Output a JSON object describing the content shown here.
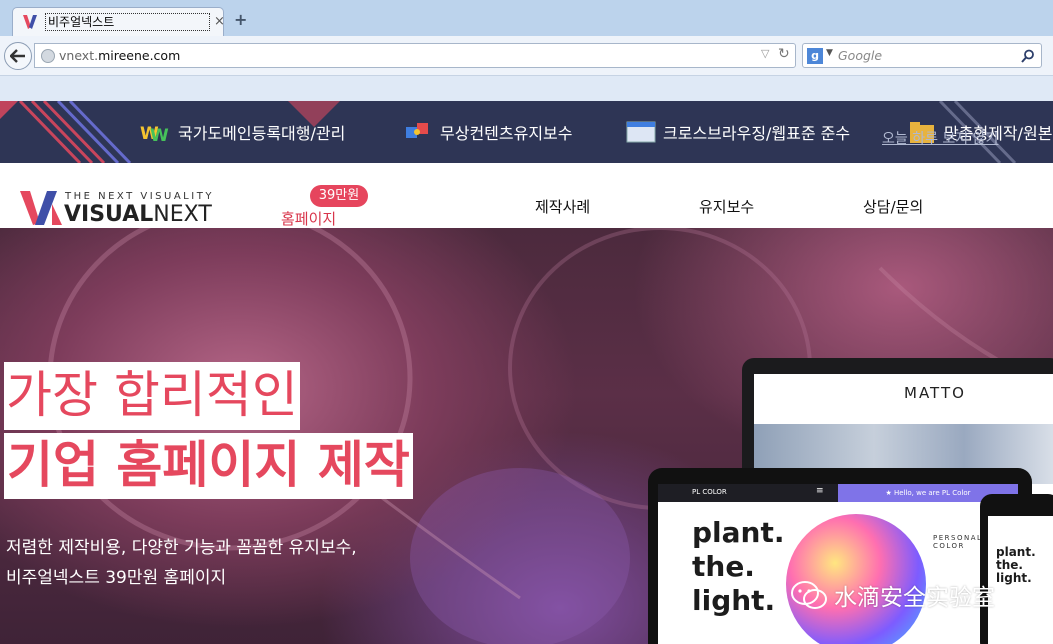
{
  "browser": {
    "tab_title": "비주얼넥스트",
    "tab_close": "×",
    "new_tab": "+",
    "url_domain_prefix": "vnext.",
    "url_domain": "mireene",
    "url_suffix": ".com",
    "search_placeholder": "Google",
    "search_engine_letter": "g"
  },
  "banner": {
    "items": [
      {
        "label": "국가도메인등록대행/관리",
        "icon": "www-icon"
      },
      {
        "label": "무상컨텐츠유지보수",
        "icon": "puzzle-icon"
      },
      {
        "label": "크로스브라우징/웹표준 준수",
        "icon": "browser-window-icon"
      },
      {
        "label": "맞춤형제작/원본",
        "icon": "folder-icon"
      }
    ],
    "dismiss_link": "오늘 하루 보지 않기"
  },
  "header": {
    "logo_tagline": "THE NEXT VISUALITY",
    "logo_bold": "VISUAL",
    "logo_light": "NEXT",
    "promo_badge": "39만원",
    "promo_label": "홈페이지",
    "nav": [
      "제작사례",
      "유지보수",
      "상담/문의"
    ]
  },
  "hero": {
    "headline_1": "가장 합리적인",
    "headline_2": "기업 홈페이지 제작",
    "sub_1": "저렴한 제작비용, 다양한 기능과 꼼꼼한 유지보수,",
    "sub_2": "비주얼넥스트 39만원 홈페이지",
    "laptop_brand": "MATTO",
    "tablet_brand": "PL COLOR",
    "tablet_hello": "★ Hello, we are PL Color",
    "tablet_big_1": "plant.",
    "tablet_big_2": "the.",
    "tablet_big_3": "light.",
    "tablet_personal": "PERSONAL COLOR",
    "phone_text": "plant. the. light."
  },
  "watermark": "水滴安全实验室",
  "colors": {
    "brand_pink": "#e5485e",
    "banner_bg": "#2e3555"
  }
}
